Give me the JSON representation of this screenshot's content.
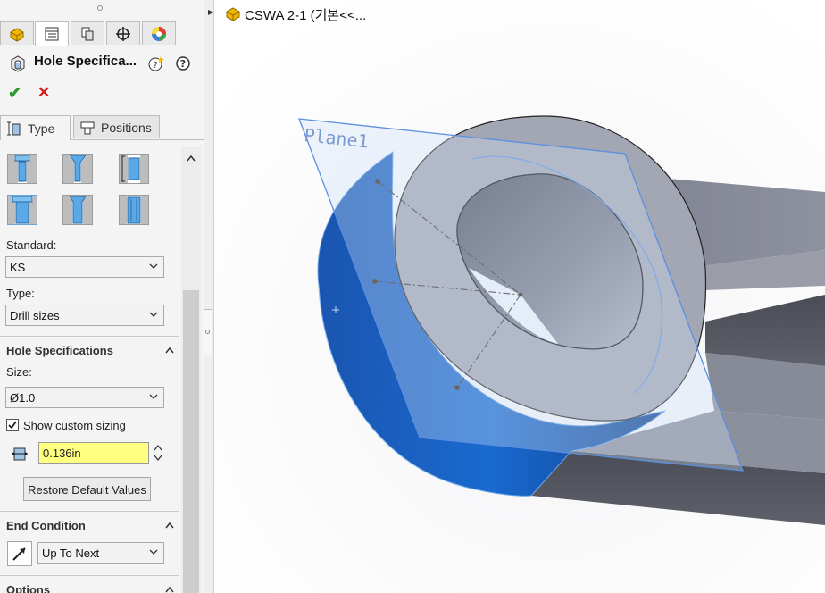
{
  "panel": {
    "tabs": [
      {
        "name": "featuremanager-tab",
        "icon": "feature-tree-icon"
      },
      {
        "name": "propertymanager-tab",
        "icon": "property-manager-icon"
      },
      {
        "name": "configurationmanager-tab",
        "icon": "configuration-icon"
      },
      {
        "name": "dimxpert-tab",
        "icon": "crosshair-icon"
      },
      {
        "name": "display-manager-tab",
        "icon": "appearance-icon"
      }
    ],
    "title": "Hole Specifica...",
    "subtabs": {
      "type": "Type",
      "positions": "Positions"
    },
    "standard_label": "Standard:",
    "standard_value": "KS",
    "type_label": "Type:",
    "type_value": "Drill sizes",
    "hole_spec_header": "Hole Specifications",
    "size_label": "Size:",
    "size_value": "Ø1.0",
    "show_custom_sizing": "Show custom sizing",
    "custom_sizing_checked": true,
    "custom_diameter": "0.136in",
    "restore_button": "Restore Default Values",
    "end_condition_header": "End Condition",
    "end_condition_value": "Up To Next",
    "options_header": "Options"
  },
  "breadcrumb": {
    "text": "CSWA 2-1  (기본<<..."
  },
  "viewport": {
    "plane_label": "Plane1"
  },
  "colors": {
    "accent_blue": "#1f5fb5",
    "highlight_yellow": "#ffff80",
    "ok_green": "#2d9a2d",
    "cancel_red": "#d61c1c"
  }
}
